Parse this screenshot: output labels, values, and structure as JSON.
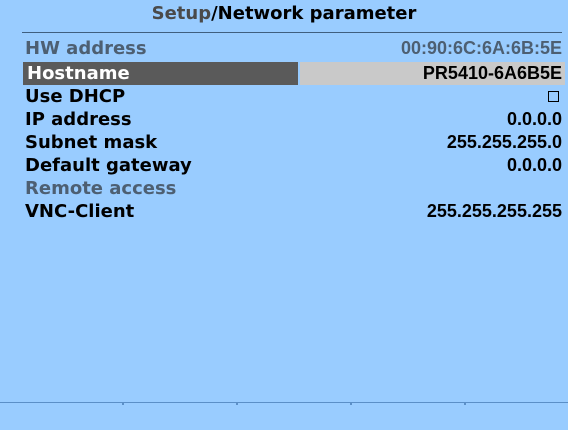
{
  "header": {
    "section": "Setup",
    "separator": "/",
    "page": "Network parameter"
  },
  "rows": [
    {
      "label": "HW address",
      "value": "00:90:6C:6A:6B:5E"
    },
    {
      "label": "Hostname",
      "value": "PR5410-6A6B5E"
    },
    {
      "label": "Use DHCP",
      "value": ""
    },
    {
      "label": "IP address",
      "value": "0.0.0.0"
    },
    {
      "label": "Subnet mask",
      "value": "255.255.255.0"
    },
    {
      "label": "Default gateway",
      "value": "0.0.0.0"
    },
    {
      "label": "Remote access",
      "value": ""
    },
    {
      "label": "VNC-Client",
      "value": "255.255.255.255"
    }
  ],
  "dhcp": {
    "checked": false
  },
  "colors": {
    "background": "#99ccff",
    "selected_label_bg": "#5a5a5a",
    "selected_value_bg": "#c9c9c9",
    "dim_text": "#4d5f72"
  }
}
